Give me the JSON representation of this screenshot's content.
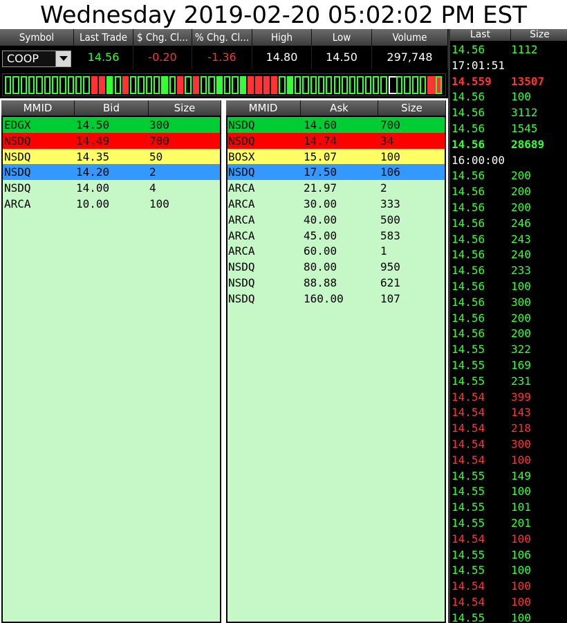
{
  "title": "Wednesday 2019-02-20 05:02:02 PM EST",
  "colors": {
    "up": "#33ff33",
    "down": "#ff3333",
    "book_bg": "#c6f7c6"
  },
  "quote": {
    "headers": [
      "Symbol",
      "Last Trade",
      "$ Chg. Cl...",
      "% Chg. Cl...",
      "High",
      "Low",
      "Volume"
    ],
    "symbol": "COOP",
    "last_trade": "14.56",
    "chg_dollar": "-0.20",
    "chg_pct": "-1.36",
    "high": "14.80",
    "low": "14.50",
    "volume": "297,748"
  },
  "tick_bar": [
    "g",
    "g",
    "g",
    "g",
    "g",
    "g",
    "g",
    "g",
    "g",
    "g",
    "g",
    "r",
    "r",
    "G",
    "g",
    "r",
    "g",
    "g",
    "g",
    "g",
    "G",
    "g",
    "r",
    "g",
    "r",
    "g",
    "g",
    "G",
    "g",
    "g",
    "G",
    "r",
    "r",
    "r",
    "r",
    "g",
    "G",
    "g",
    "g",
    "g",
    "g",
    "g",
    "g",
    "g",
    "g",
    "g",
    "g",
    "g",
    "g",
    "w",
    "g",
    "g",
    "g",
    "g",
    "R",
    "g"
  ],
  "bid_book": {
    "headers": [
      "MMID",
      "Bid",
      "Size"
    ],
    "rows": [
      {
        "mmid": "EDGX",
        "price": "14.50",
        "size": "300",
        "bg": "#00cc33"
      },
      {
        "mmid": "NSDQ",
        "price": "14.49",
        "size": "700",
        "bg": "#ff0000"
      },
      {
        "mmid": "NSDQ",
        "price": "14.35",
        "size": "50",
        "bg": "#ffff66"
      },
      {
        "mmid": "NSDQ",
        "price": "14.20",
        "size": "2",
        "bg": "#3399ff"
      },
      {
        "mmid": "NSDQ",
        "price": "14.00",
        "size": "4",
        "bg": ""
      },
      {
        "mmid": "ARCA",
        "price": "10.00",
        "size": "100",
        "bg": ""
      }
    ]
  },
  "ask_book": {
    "headers": [
      "MMID",
      "Ask",
      "Size"
    ],
    "rows": [
      {
        "mmid": "NSDQ",
        "price": "14.60",
        "size": "700",
        "bg": "#00cc33"
      },
      {
        "mmid": "NSDQ",
        "price": "14.74",
        "size": "34",
        "bg": "#ff0000"
      },
      {
        "mmid": "BOSX",
        "price": "15.07",
        "size": "100",
        "bg": "#ffff66"
      },
      {
        "mmid": "NSDQ",
        "price": "17.50",
        "size": "106",
        "bg": "#3399ff"
      },
      {
        "mmid": "ARCA",
        "price": "21.97",
        "size": "2",
        "bg": ""
      },
      {
        "mmid": "ARCA",
        "price": "30.00",
        "size": "333",
        "bg": ""
      },
      {
        "mmid": "ARCA",
        "price": "40.00",
        "size": "500",
        "bg": ""
      },
      {
        "mmid": "ARCA",
        "price": "45.00",
        "size": "583",
        "bg": ""
      },
      {
        "mmid": "ARCA",
        "price": "60.00",
        "size": "1",
        "bg": ""
      },
      {
        "mmid": "NSDQ",
        "price": "80.00",
        "size": "950",
        "bg": ""
      },
      {
        "mmid": "NSDQ",
        "price": "88.88",
        "size": "621",
        "bg": ""
      },
      {
        "mmid": "NSDQ",
        "price": "160.00",
        "size": "107",
        "bg": ""
      }
    ]
  },
  "time_sales": {
    "headers": [
      "Last",
      "Size"
    ],
    "rows": [
      {
        "last": "14.56",
        "size": "1112",
        "dir": "up",
        "bold": false
      },
      {
        "last": "17:01:51",
        "size": "",
        "dir": "time",
        "bold": false
      },
      {
        "last": "14.559",
        "size": "13507",
        "dir": "down",
        "bold": true
      },
      {
        "last": "14.56",
        "size": "100",
        "dir": "up",
        "bold": false
      },
      {
        "last": "14.56",
        "size": "3112",
        "dir": "up",
        "bold": false
      },
      {
        "last": "14.56",
        "size": "1545",
        "dir": "up",
        "bold": false
      },
      {
        "last": "14.56",
        "size": "28689",
        "dir": "up",
        "bold": true
      },
      {
        "last": "16:00:00",
        "size": "",
        "dir": "time",
        "bold": false
      },
      {
        "last": "14.56",
        "size": "200",
        "dir": "up",
        "bold": false
      },
      {
        "last": "14.56",
        "size": "200",
        "dir": "up",
        "bold": false
      },
      {
        "last": "14.56",
        "size": "200",
        "dir": "up",
        "bold": false
      },
      {
        "last": "14.56",
        "size": "246",
        "dir": "up",
        "bold": false
      },
      {
        "last": "14.56",
        "size": "243",
        "dir": "up",
        "bold": false
      },
      {
        "last": "14.56",
        "size": "240",
        "dir": "up",
        "bold": false
      },
      {
        "last": "14.56",
        "size": "233",
        "dir": "up",
        "bold": false
      },
      {
        "last": "14.56",
        "size": "100",
        "dir": "up",
        "bold": false
      },
      {
        "last": "14.56",
        "size": "300",
        "dir": "up",
        "bold": false
      },
      {
        "last": "14.56",
        "size": "200",
        "dir": "up",
        "bold": false
      },
      {
        "last": "14.56",
        "size": "200",
        "dir": "up",
        "bold": false
      },
      {
        "last": "14.55",
        "size": "322",
        "dir": "up",
        "bold": false
      },
      {
        "last": "14.55",
        "size": "169",
        "dir": "up",
        "bold": false
      },
      {
        "last": "14.55",
        "size": "231",
        "dir": "up",
        "bold": false
      },
      {
        "last": "14.54",
        "size": "399",
        "dir": "down",
        "bold": false
      },
      {
        "last": "14.54",
        "size": "143",
        "dir": "down",
        "bold": false
      },
      {
        "last": "14.54",
        "size": "218",
        "dir": "down",
        "bold": false
      },
      {
        "last": "14.54",
        "size": "300",
        "dir": "down",
        "bold": false
      },
      {
        "last": "14.54",
        "size": "100",
        "dir": "down",
        "bold": false
      },
      {
        "last": "14.55",
        "size": "149",
        "dir": "up",
        "bold": false
      },
      {
        "last": "14.55",
        "size": "100",
        "dir": "up",
        "bold": false
      },
      {
        "last": "14.55",
        "size": "101",
        "dir": "up",
        "bold": false
      },
      {
        "last": "14.55",
        "size": "201",
        "dir": "up",
        "bold": false
      },
      {
        "last": "14.54",
        "size": "100",
        "dir": "down",
        "bold": false
      },
      {
        "last": "14.55",
        "size": "106",
        "dir": "up",
        "bold": false
      },
      {
        "last": "14.55",
        "size": "100",
        "dir": "up",
        "bold": false
      },
      {
        "last": "14.54",
        "size": "100",
        "dir": "down",
        "bold": false
      },
      {
        "last": "14.54",
        "size": "100",
        "dir": "down",
        "bold": false
      },
      {
        "last": "14.55",
        "size": "100",
        "dir": "up",
        "bold": false
      }
    ]
  }
}
